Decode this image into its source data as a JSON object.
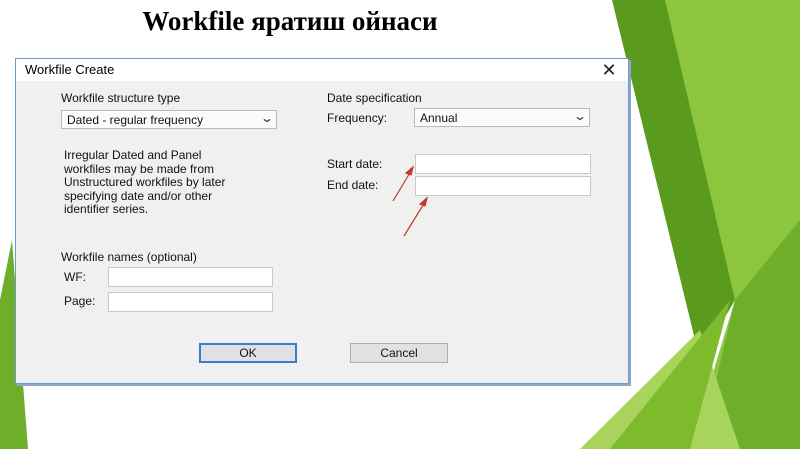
{
  "slide": {
    "title": "Workfile яратиш ойнаси"
  },
  "dialog": {
    "title": "Workfile Create",
    "structure": {
      "heading": "Workfile structure type",
      "selected": "Dated - regular frequency"
    },
    "description": [
      "Irregular Dated and Panel",
      "workfiles may be made from",
      "Unstructured workfiles by later",
      "specifying date and/or other",
      "identifier series."
    ],
    "date_spec": {
      "heading": "Date specification",
      "frequency_label": "Frequency:",
      "frequency_value": "Annual",
      "start_label": "Start date:",
      "start_value": "",
      "end_label": "End date:",
      "end_value": ""
    },
    "names": {
      "heading": "Workfile names (optional)",
      "wf_label": "WF:",
      "wf_value": "",
      "page_label": "Page:",
      "page_value": ""
    },
    "ok_label": "OK",
    "cancel_label": "Cancel"
  },
  "colors": {
    "green_dark": "#5a9a1c",
    "green_mid": "#7dbb2c",
    "green_light": "#a8d45c",
    "arrow": "#c0392b",
    "focus_border": "#3d7bd0"
  },
  "icons": {
    "close": "close-icon",
    "dropdown": "chevron-down-icon"
  }
}
